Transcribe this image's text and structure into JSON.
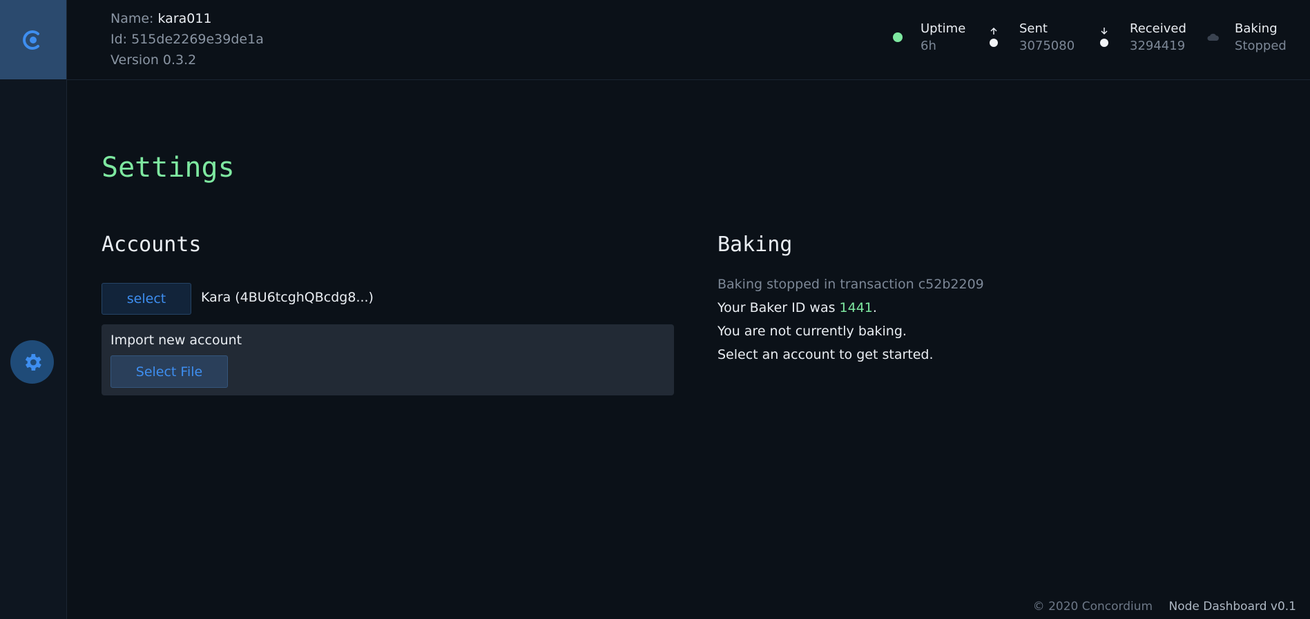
{
  "node": {
    "name_label": "Name:",
    "name_value": "kara011",
    "id_label": "Id:",
    "id_value": "515de2269e39de1a",
    "version_label": "Version",
    "version_value": "0.3.2"
  },
  "stats": {
    "uptime": {
      "label": "Uptime",
      "value": "6h",
      "color": "#7ee8a0",
      "icon": "status-dot-icon"
    },
    "sent": {
      "label": "Sent",
      "value": "3075080",
      "icon": "arrow-up-icon"
    },
    "received": {
      "label": "Received",
      "value": "3294419",
      "icon": "arrow-down-icon"
    },
    "baking": {
      "label": "Baking",
      "value": "Stopped",
      "icon": "cloud-icon"
    }
  },
  "page": {
    "title": "Settings"
  },
  "accounts": {
    "title": "Accounts",
    "select_label": "select",
    "account_name": "Kara (4BU6tcghQBcdg8...)",
    "import_label": "Import new account",
    "file_button": "Select File"
  },
  "baking": {
    "title": "Baking",
    "status": "Baking stopped in transaction c52b2209",
    "baker_prefix": "Your Baker ID was ",
    "baker_id": "1441",
    "baker_suffix": ".",
    "line_not_baking": "You are not currently baking.",
    "line_get_started": "Select an account to get started."
  },
  "footer": {
    "copyright": "© 2020 Concordium",
    "app_version": "Node Dashboard v0.1"
  },
  "colors": {
    "accent_blue": "#3e8ef0",
    "accent_green": "#7ee8a0",
    "background": "#0b1118"
  }
}
